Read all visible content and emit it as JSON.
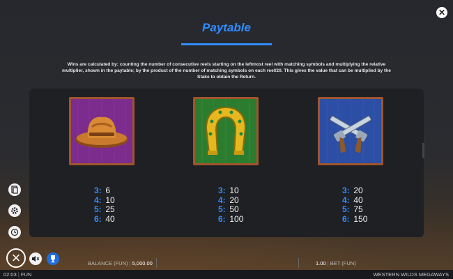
{
  "header": {
    "title": "Paytable",
    "close_icon": "close-icon"
  },
  "description": "Wins are calculated by: counting the number of consecutive reels starting on the leftmost reel with matching symbols and multiplying the relative multiplier, shown in the paytable; by the product of the number of matching symbols on each reel/20. This gives the value that can be multiplied by the Stake to obtain the Return.",
  "symbols": [
    {
      "name": "cowboy-hat",
      "bg": "#7a2a8a",
      "pays": [
        {
          "count": "3:",
          "value": "6"
        },
        {
          "count": "4:",
          "value": "10"
        },
        {
          "count": "5:",
          "value": "25"
        },
        {
          "count": "6:",
          "value": "40"
        }
      ]
    },
    {
      "name": "horseshoe",
      "bg": "#2a7a2e",
      "pays": [
        {
          "count": "3:",
          "value": "10"
        },
        {
          "count": "4:",
          "value": "20"
        },
        {
          "count": "5:",
          "value": "50"
        },
        {
          "count": "6:",
          "value": "100"
        }
      ]
    },
    {
      "name": "crossed-pistols",
      "bg": "#2a4aa0",
      "pays": [
        {
          "count": "3:",
          "value": "20"
        },
        {
          "count": "4:",
          "value": "40"
        },
        {
          "count": "5:",
          "value": "75"
        },
        {
          "count": "6:",
          "value": "150"
        }
      ]
    }
  ],
  "footer": {
    "time": "02:03",
    "mode": "FUN",
    "balance_label": "BALANCE (FUN)",
    "balance_value": "5,000.00",
    "bet_value": "1.00",
    "bet_label": "BET (FUN)",
    "game_name": "WESTERN WILDS MEGAWAYS"
  },
  "colors": {
    "accent": "#2f8cff",
    "frame": "#a0552c"
  }
}
